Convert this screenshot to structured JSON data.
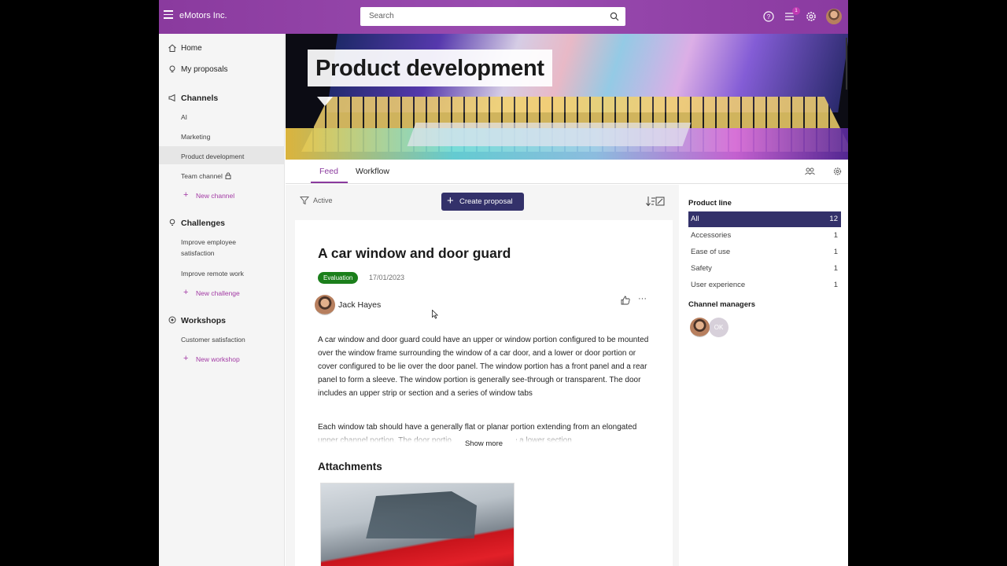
{
  "app": {
    "title": "eMotors Inc."
  },
  "search": {
    "placeholder": "Search"
  },
  "topbar": {
    "notification_count": "1"
  },
  "sidebar": {
    "home": "Home",
    "my_proposals": "My proposals",
    "channels": {
      "header": "Channels",
      "items": [
        "AI",
        "Marketing",
        "Product development",
        "Team channel"
      ],
      "new": "New channel"
    },
    "challenges": {
      "header": "Challenges",
      "items": [
        "Improve employee satisfaction",
        "Improve remote work"
      ],
      "new": "New challenge"
    },
    "workshops": {
      "header": "Workshops",
      "items": [
        "Customer satisfaction"
      ],
      "new": "New workshop"
    }
  },
  "hero": {
    "title": "Product development"
  },
  "tabs": [
    "Feed",
    "Workflow"
  ],
  "feed": {
    "filter_label": "Active",
    "create_button": "Create proposal",
    "proposal": {
      "title": "A car window and door guard",
      "status": "Evaluation",
      "date": "17/01/2023",
      "author": "Jack Hayes",
      "body_1": "A car window and door guard could have an upper or window portion configured to be mounted over the window frame surrounding the window of a car door, and a lower or door portion or cover configured to be lie over the door panel. The window portion has a front panel and a rear panel to form a sleeve. The window portion is generally see-through or transparent. The door includes an upper strip or section and a series of window tabs",
      "body_2": "Each window tab should have a generally flat or planar portion extending from an elongated upper channel portion. The door portion also should have a lower section",
      "show_more": "Show more",
      "attachments_title": "Attachments"
    }
  },
  "right_panel": {
    "product_line_title": "Product line",
    "product_lines": [
      {
        "name": "All",
        "count": "12"
      },
      {
        "name": "Accessories",
        "count": "1"
      },
      {
        "name": "Ease of use",
        "count": "1"
      },
      {
        "name": "Safety",
        "count": "1"
      },
      {
        "name": "User experience",
        "count": "1"
      }
    ],
    "channel_managers_title": "Channel managers",
    "manager_initials": "OK"
  },
  "colors": {
    "brand": "#8a3a9e",
    "primary_button": "#33316a",
    "status_green": "#1b7f1b"
  }
}
